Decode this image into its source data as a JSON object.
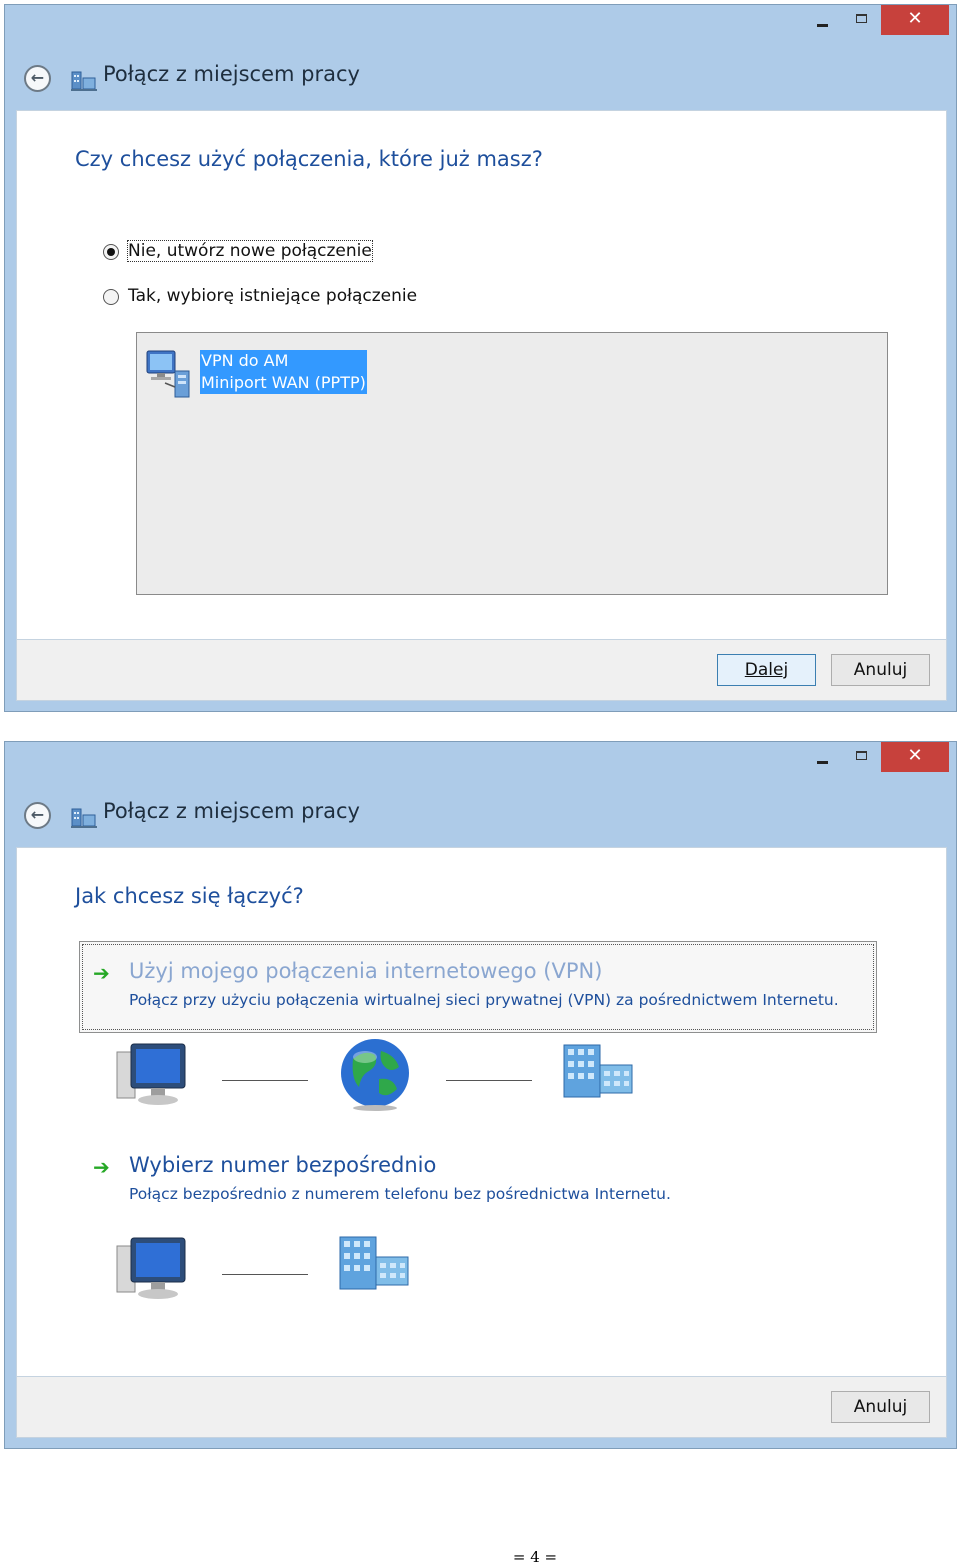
{
  "window1": {
    "title": "Połącz z miejscem pracy",
    "heading": "Czy chcesz użyć połączenia, które już masz?",
    "radio_no": {
      "label": "Nie, utwórz nowe połączenie",
      "selected": true
    },
    "radio_yes": {
      "label": "Tak, wybiorę istniejące połączenie",
      "selected": false
    },
    "connections": [
      {
        "name": "VPN do AM",
        "type": "Miniport WAN (PPTP)",
        "icon": "network-connection-icon"
      }
    ],
    "buttons": {
      "next": "Dalej",
      "cancel": "Anuluj"
    }
  },
  "window2": {
    "title": "Połącz z miejscem pracy",
    "heading": "Jak chcesz się łączyć?",
    "option_vpn": {
      "title": "Użyj mojego połączenia internetowego (VPN)",
      "description": "Połącz przy użyciu połączenia wirtualnej sieci prywatnej (VPN) za pośrednictwem Internetu."
    },
    "option_dial": {
      "title": "Wybierz numer bezpośrednio",
      "description": "Połącz bezpośrednio z numerem telefonu bez pośrednictwa Internetu."
    },
    "buttons": {
      "cancel": "Anuluj"
    }
  },
  "page_number": "= 4 =",
  "colors": {
    "titlebar": "#aecbe8",
    "close_button": "#c7413c",
    "heading": "#1e4f9c",
    "selection": "#3399ff",
    "arrow": "#26a826"
  }
}
